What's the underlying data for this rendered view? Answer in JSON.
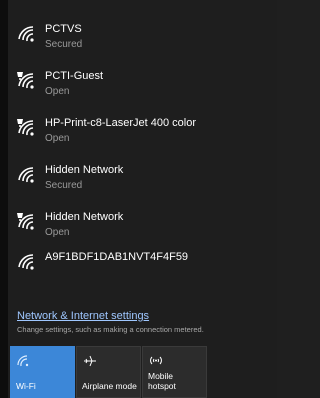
{
  "networks": [
    {
      "name": "PCTVS",
      "status": "Secured",
      "icon": "wifi-icon"
    },
    {
      "name": "PCTI-Guest",
      "status": "Open",
      "icon": "wifi-open-icon"
    },
    {
      "name": "HP-Print-c8-LaserJet 400 color",
      "status": "Open",
      "icon": "wifi-open-icon"
    },
    {
      "name": "Hidden Network",
      "status": "Secured",
      "icon": "wifi-icon"
    },
    {
      "name": "Hidden Network",
      "status": "Open",
      "icon": "wifi-open-icon"
    },
    {
      "name": "A9F1BDF1DAB1NVT4F4F59",
      "status": "",
      "icon": "wifi-icon"
    }
  ],
  "settings": {
    "link": "Network & Internet settings",
    "hint": "Change settings, such as making a connection metered."
  },
  "tiles": [
    {
      "label": "Wi-Fi",
      "icon": "wifi-tile-icon",
      "active": true
    },
    {
      "label": "Airplane mode",
      "icon": "airplane-icon",
      "active": false
    },
    {
      "label": "Mobile\nhotspot",
      "label_line1": "Mobile",
      "label_line2": "hotspot",
      "icon": "hotspot-icon",
      "active": false
    }
  ],
  "colors": {
    "background": "#1e1e1e",
    "accent": "#3c87d8",
    "link": "#9fc7ff",
    "secondary_text": "#9a9a9a"
  }
}
